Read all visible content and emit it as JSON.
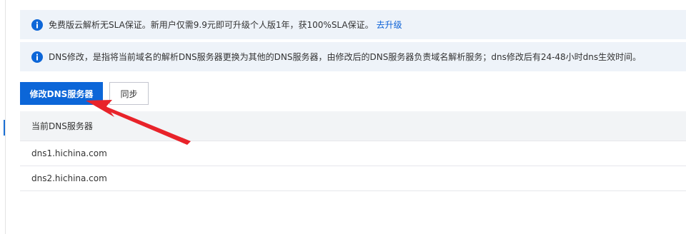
{
  "notices": [
    {
      "text": "免费版云解析无SLA保证。新用户仅需9.9元即可升级个人版1年，获100%SLA保证。",
      "link": "去升级",
      "icon": "info-icon"
    },
    {
      "text": "DNS修改，是指将当前域名的解析DNS服务器更换为其他的DNS服务器，由修改后的DNS服务器负责域名解析服务；dns修改后有24-48小时dns生效时间。",
      "icon": "info-icon"
    }
  ],
  "toolbar": {
    "modify_label": "修改DNS服务器",
    "sync_label": "同步"
  },
  "table": {
    "header": "当前DNS服务器",
    "rows": [
      "dns1.hichina.com",
      "dns2.hichina.com"
    ]
  },
  "colors": {
    "primary": "#0c66d8",
    "link": "#0d62d6",
    "notice_bg": "#eef3f9",
    "annotation_arrow": "#e8232a"
  }
}
